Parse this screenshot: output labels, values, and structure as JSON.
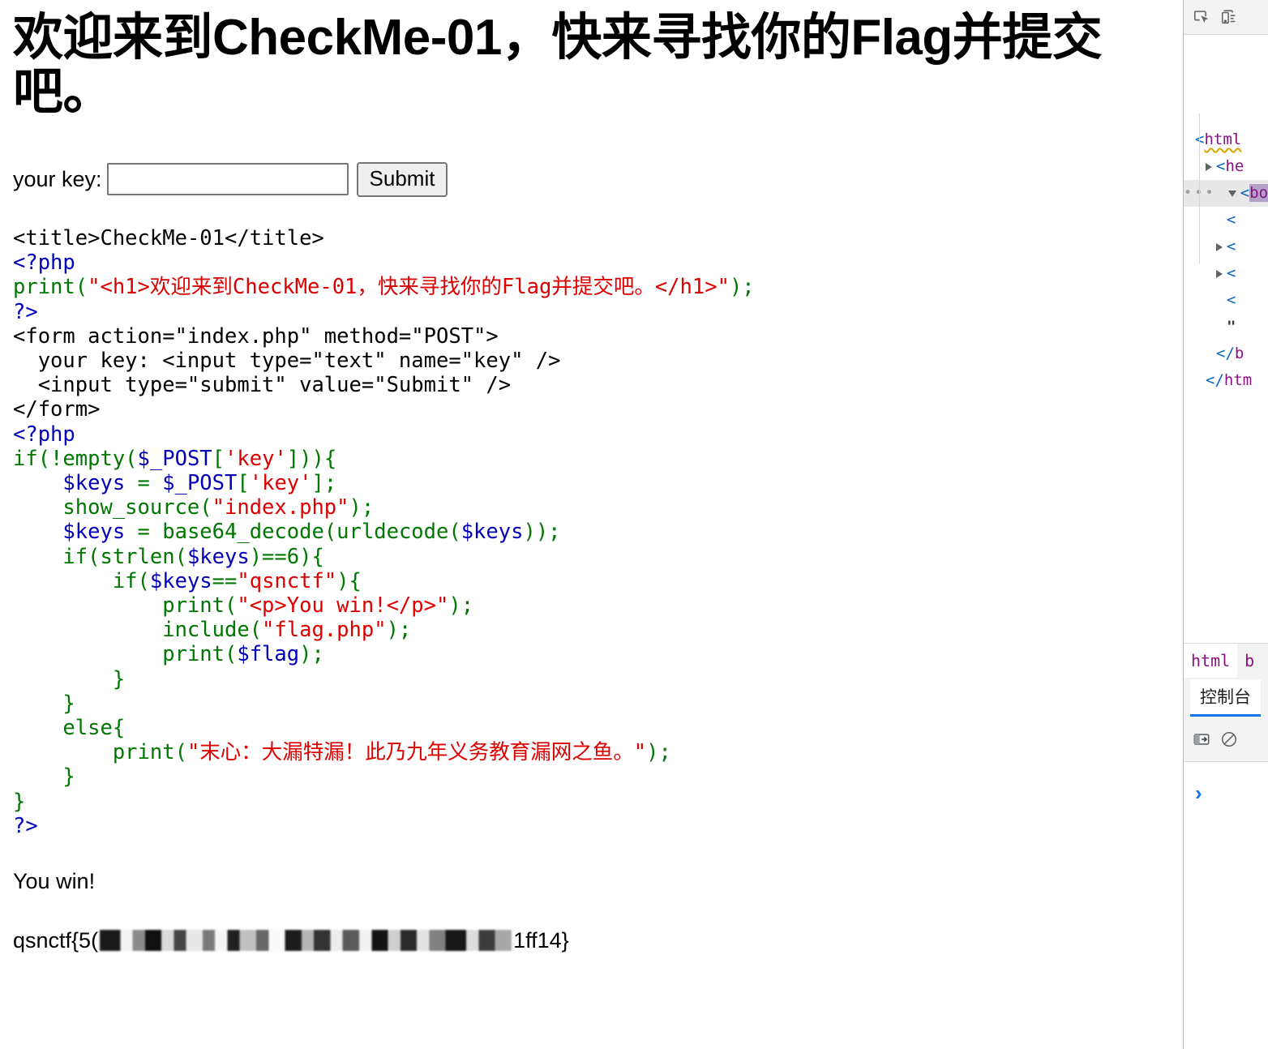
{
  "page": {
    "heading": "欢迎来到CheckMe-01，快来寻找你的Flag并提交吧。",
    "form": {
      "label": "your key:",
      "input_value": "",
      "input_placeholder": "",
      "submit_label": "Submit"
    },
    "result": {
      "win_message": "You win!",
      "flag_prefix": "qsnctf{5(",
      "flag_redacted": "",
      "flag_suffix": "1ff14}"
    }
  },
  "source_code": {
    "lines": [
      [
        {
          "t": "<title>CheckMe-01</title>",
          "c": "html"
        }
      ],
      [
        {
          "t": "<?php",
          "c": "kw"
        }
      ],
      [
        {
          "t": "print(",
          "c": "code"
        },
        {
          "t": "\"<h1>欢迎来到CheckMe-01，快来寻找你的Flag并提交吧。</h1>\"",
          "c": "str"
        },
        {
          "t": ");",
          "c": "code"
        }
      ],
      [
        {
          "t": "?>",
          "c": "kw"
        }
      ],
      [
        {
          "t": "<form action=\"index.php\" method=\"POST\">",
          "c": "html"
        }
      ],
      [
        {
          "t": "  your key: <input type=\"text\" name=\"key\" />",
          "c": "html"
        }
      ],
      [
        {
          "t": "  <input type=\"submit\" value=\"Submit\" />",
          "c": "html"
        }
      ],
      [
        {
          "t": "</form>",
          "c": "html"
        }
      ],
      [
        {
          "t": "<?php",
          "c": "kw"
        }
      ],
      [
        {
          "t": "if(!empty(",
          "c": "code"
        },
        {
          "t": "$_POST",
          "c": "kw"
        },
        {
          "t": "[",
          "c": "code"
        },
        {
          "t": "'key'",
          "c": "str"
        },
        {
          "t": "])){",
          "c": "code"
        }
      ],
      [
        {
          "t": "    ",
          "c": "code"
        },
        {
          "t": "$keys",
          "c": "kw"
        },
        {
          "t": " = ",
          "c": "code"
        },
        {
          "t": "$_POST",
          "c": "kw"
        },
        {
          "t": "[",
          "c": "code"
        },
        {
          "t": "'key'",
          "c": "str"
        },
        {
          "t": "];",
          "c": "code"
        }
      ],
      [
        {
          "t": "    show_source(",
          "c": "code"
        },
        {
          "t": "\"index.php\"",
          "c": "str"
        },
        {
          "t": ");",
          "c": "code"
        }
      ],
      [
        {
          "t": "    ",
          "c": "code"
        },
        {
          "t": "$keys",
          "c": "kw"
        },
        {
          "t": " = base64_decode(urldecode(",
          "c": "code"
        },
        {
          "t": "$keys",
          "c": "kw"
        },
        {
          "t": "));",
          "c": "code"
        }
      ],
      [
        {
          "t": "    if(strlen(",
          "c": "code"
        },
        {
          "t": "$keys",
          "c": "kw"
        },
        {
          "t": ")==6){",
          "c": "code"
        }
      ],
      [
        {
          "t": "        if(",
          "c": "code"
        },
        {
          "t": "$keys",
          "c": "kw"
        },
        {
          "t": "==",
          "c": "code"
        },
        {
          "t": "\"qsnctf\"",
          "c": "str"
        },
        {
          "t": "){",
          "c": "code"
        }
      ],
      [
        {
          "t": "            print(",
          "c": "code"
        },
        {
          "t": "\"<p>You win!</p>\"",
          "c": "str"
        },
        {
          "t": ");",
          "c": "code"
        }
      ],
      [
        {
          "t": "            include(",
          "c": "code"
        },
        {
          "t": "\"flag.php\"",
          "c": "str"
        },
        {
          "t": ");",
          "c": "code"
        }
      ],
      [
        {
          "t": "            print(",
          "c": "code"
        },
        {
          "t": "$flag",
          "c": "kw"
        },
        {
          "t": ");",
          "c": "code"
        }
      ],
      [
        {
          "t": "        }",
          "c": "code"
        }
      ],
      [
        {
          "t": "    }",
          "c": "code"
        }
      ],
      [
        {
          "t": "    else{",
          "c": "code"
        }
      ],
      [
        {
          "t": "        print(",
          "c": "code"
        },
        {
          "t": "\"末心：大漏特漏！此乃九年义务教育漏网之鱼。\"",
          "c": "str"
        },
        {
          "t": ");",
          "c": "code"
        }
      ],
      [
        {
          "t": "    }",
          "c": "code"
        }
      ],
      [
        {
          "t": "}",
          "c": "code"
        }
      ],
      [
        {
          "t": "?>",
          "c": "kw"
        }
      ]
    ]
  },
  "devtools": {
    "toolbar_icons": [
      "inspect-element-icon",
      "device-toolbar-icon"
    ],
    "dom_tree": [
      {
        "indent": 0,
        "twisty": "none",
        "text": "<html",
        "selected": false,
        "squiggle": true,
        "dots": false
      },
      {
        "indent": 1,
        "twisty": "closed",
        "text": "<he",
        "selected": false,
        "squiggle": false,
        "dots": false
      },
      {
        "indent": 1,
        "twisty": "open",
        "text": "<bo",
        "selected": true,
        "squiggle": false,
        "dots": true
      },
      {
        "indent": 3,
        "twisty": "none",
        "text": "<",
        "selected": false,
        "squiggle": false,
        "dots": false
      },
      {
        "indent": 2,
        "twisty": "closed",
        "text": "<",
        "selected": false,
        "squiggle": false,
        "dots": false
      },
      {
        "indent": 2,
        "twisty": "closed",
        "text": "<",
        "selected": false,
        "squiggle": false,
        "dots": false
      },
      {
        "indent": 3,
        "twisty": "none",
        "text": "<",
        "selected": false,
        "squiggle": false,
        "dots": false
      },
      {
        "indent": 3,
        "twisty": "none",
        "text": "\"",
        "selected": false,
        "squiggle": false,
        "dots": false
      },
      {
        "indent": 2,
        "twisty": "none",
        "text": "</b",
        "selected": false,
        "squiggle": false,
        "dots": false
      },
      {
        "indent": 1,
        "twisty": "none",
        "text": "</htm",
        "selected": false,
        "squiggle": false,
        "dots": false
      }
    ],
    "breadcrumb": [
      "html",
      "b"
    ],
    "console_tab_label": "控制台",
    "console_toolbar_icons": [
      "top-frame-selector-icon",
      "clear-console-icon"
    ],
    "console_prompt": "›"
  },
  "colors": {
    "php_tag": "#0000BB",
    "php_code": "#007700",
    "php_string": "#DD0000",
    "devtools_tag": "#881280",
    "devtools_punct": "#0b67c2",
    "devtools_accent": "#1a73e8",
    "selection": "#b4a0c8"
  }
}
